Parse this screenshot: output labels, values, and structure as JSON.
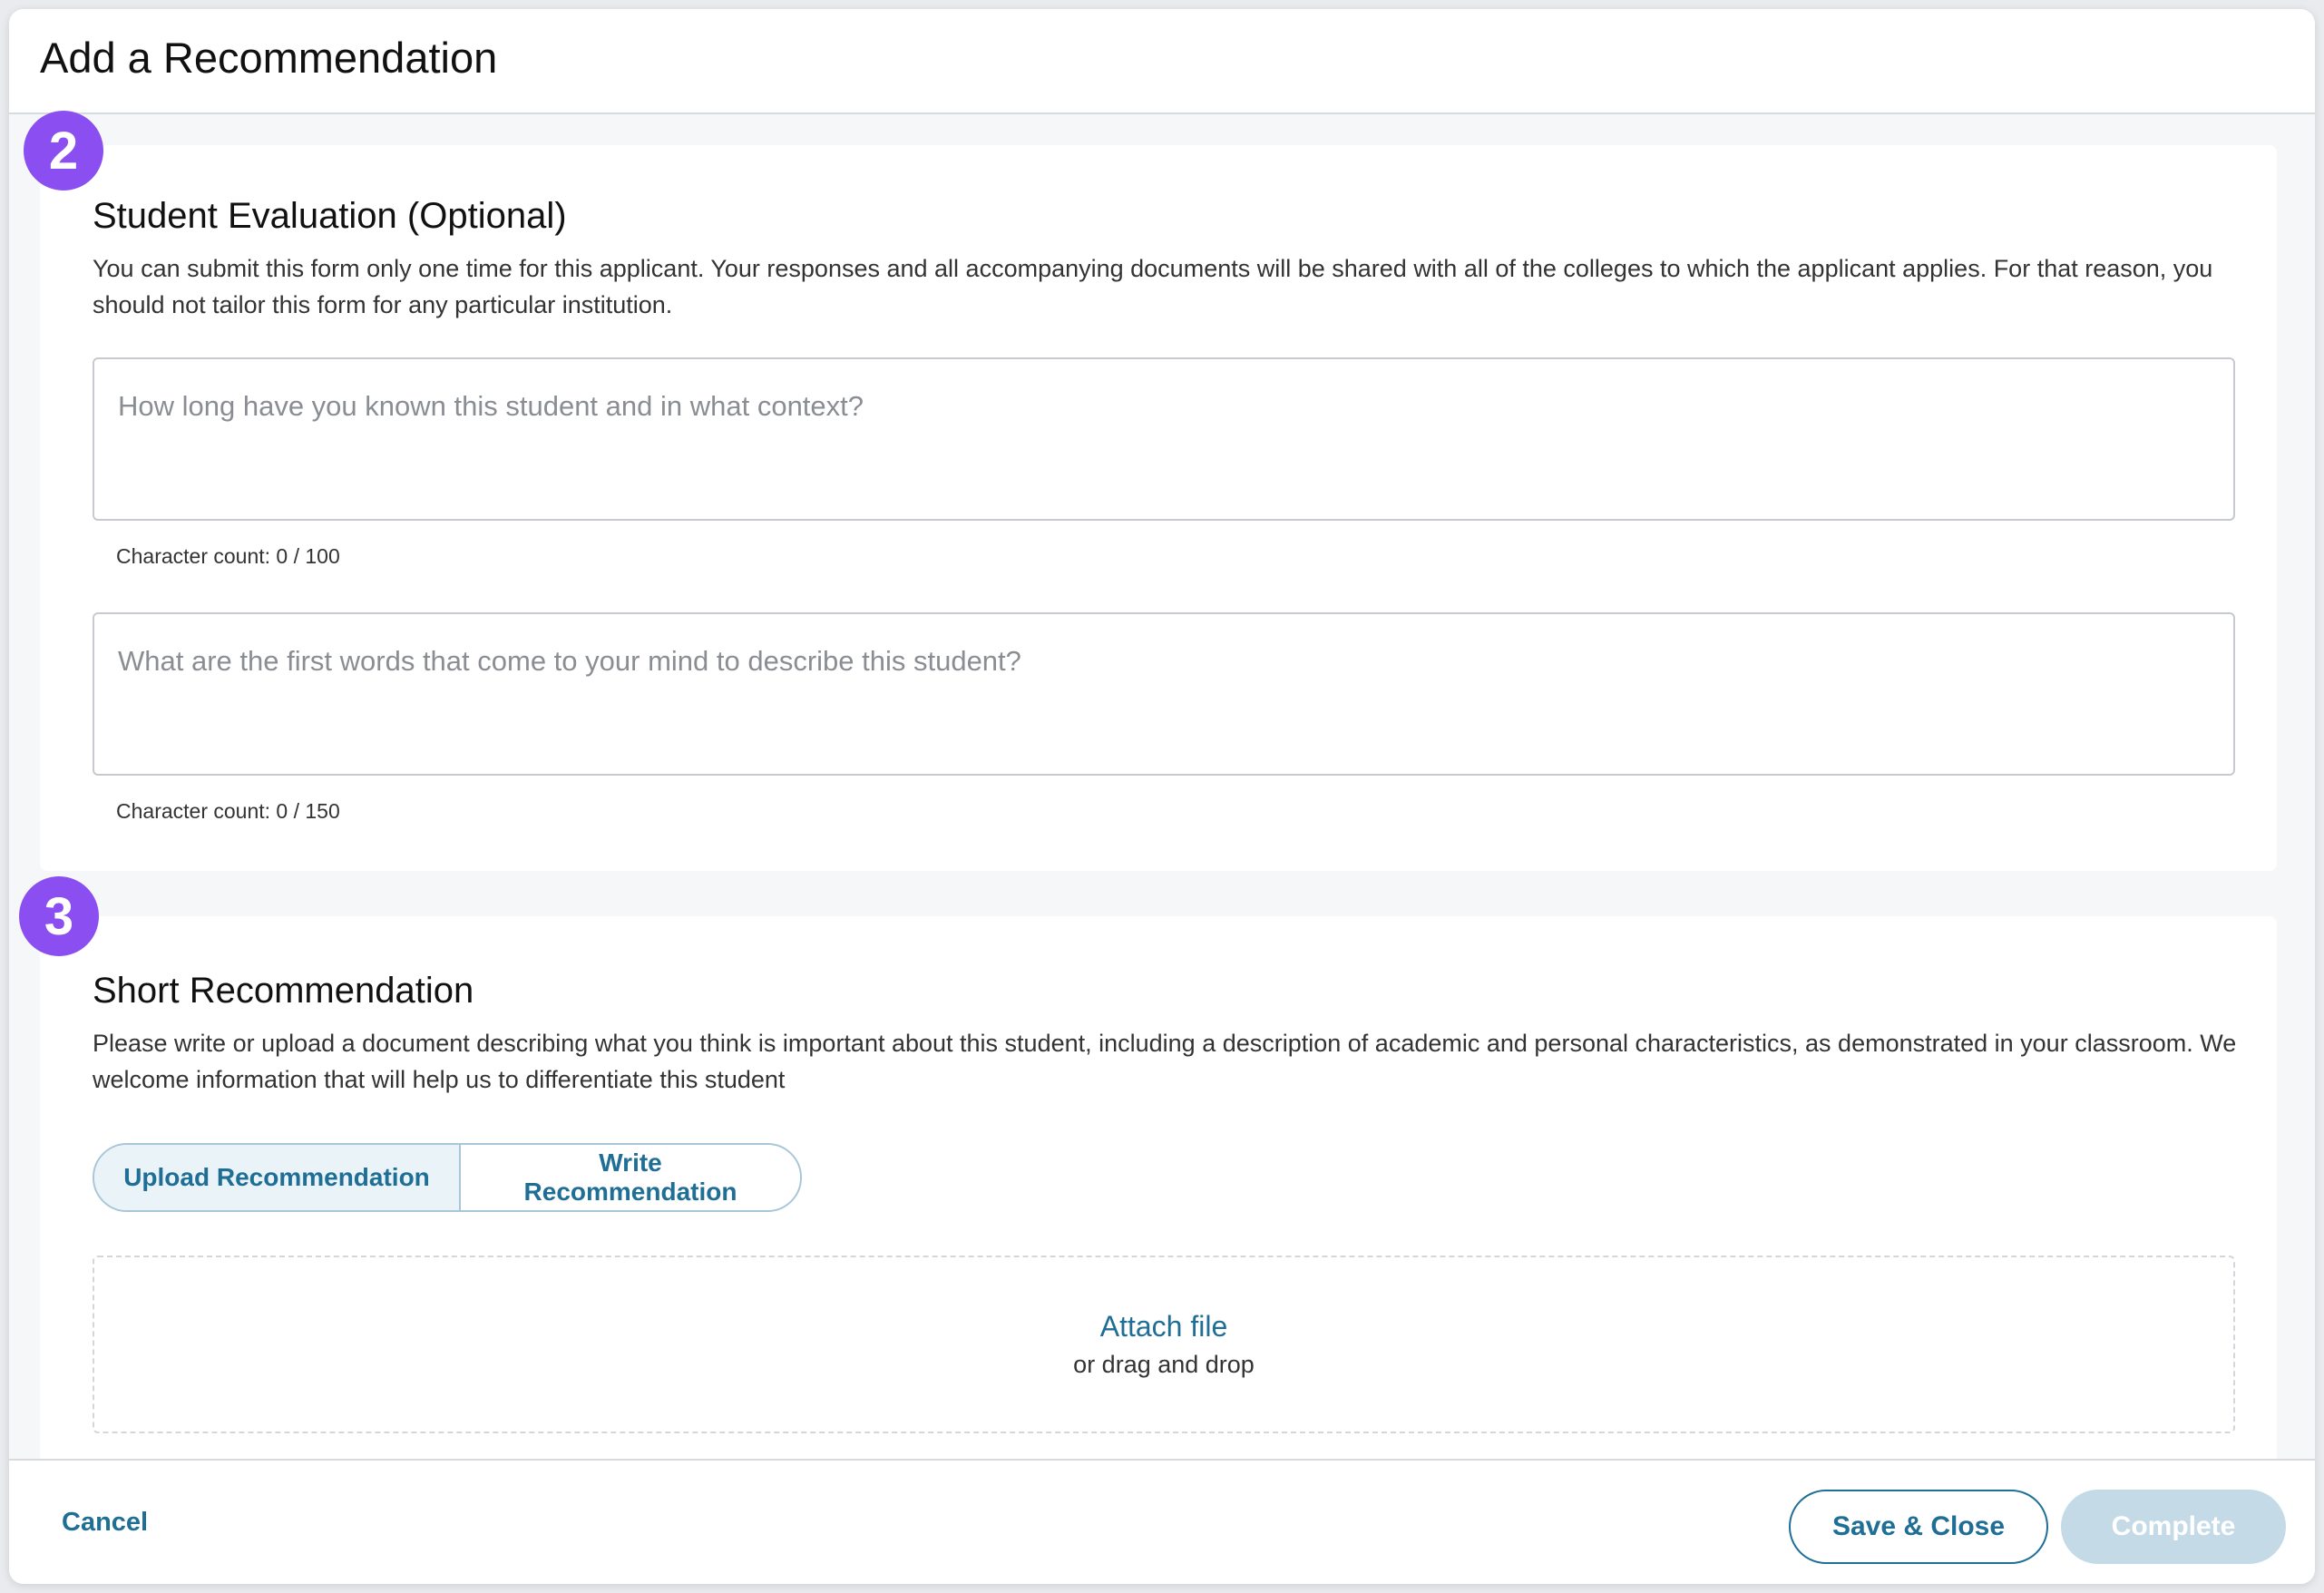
{
  "modal": {
    "title": "Add a Recommendation"
  },
  "sections": [
    {
      "step": "2",
      "title": "Student Evaluation (Optional)",
      "description": "You can submit this form only one time for this applicant. Your responses and all accompanying documents will be shared with all of the colleges to which the applicant applies. For that reason, you should not tailor this form for any particular institution.",
      "fields": [
        {
          "placeholder": "How long have you known this student and in what context?",
          "value": "",
          "char_count": "Character count: 0 / 100"
        },
        {
          "placeholder": "What are the first words that come to your mind to describe this student?",
          "value": "",
          "char_count": "Character count: 0 / 150"
        }
      ]
    },
    {
      "step": "3",
      "title": "Short Recommendation",
      "description": "Please write or upload a document describing what you think is important about this student, including a description of academic and personal characteristics, as demonstrated in your classroom. We welcome information that will help us to differentiate this student",
      "toggle": {
        "options": [
          "Upload Recommendation",
          "Write Recommendation"
        ],
        "selected": "Upload Recommendation"
      },
      "dropzone": {
        "link": "Attach file",
        "hint": "or drag and drop"
      }
    }
  ],
  "footer": {
    "cancel": "Cancel",
    "save_close": "Save & Close",
    "complete": "Complete"
  },
  "colors": {
    "accent": "#1f6e96",
    "step_badge": "#8b4ef0",
    "disabled_button": "#c4dbe7"
  }
}
